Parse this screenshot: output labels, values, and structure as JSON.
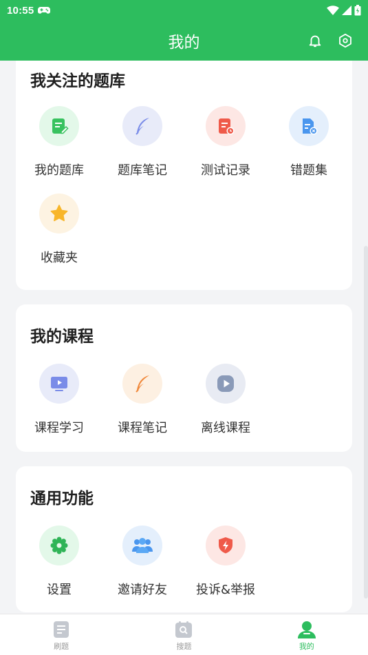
{
  "status_bar": {
    "time": "10:55"
  },
  "header": {
    "title": "我的"
  },
  "sections": {
    "question_bank": {
      "title": "我关注的题库",
      "items": [
        "我的题库",
        "题库笔记",
        "测试记录",
        "错题集",
        "收藏夹"
      ]
    },
    "courses": {
      "title": "我的课程",
      "items": [
        "课程学习",
        "课程笔记",
        "离线课程"
      ]
    },
    "general": {
      "title": "通用功能",
      "items": [
        "设置",
        "邀请好友",
        "投诉&举报"
      ]
    }
  },
  "tabbar": {
    "items": [
      {
        "label": "刷题",
        "icon": "practice-icon"
      },
      {
        "label": "搜题",
        "icon": "search-question-icon"
      },
      {
        "label": "我的",
        "icon": "profile-icon",
        "active": true
      }
    ]
  },
  "colors": {
    "brand": "#2dbd5e",
    "background": "#f3f4f6"
  }
}
